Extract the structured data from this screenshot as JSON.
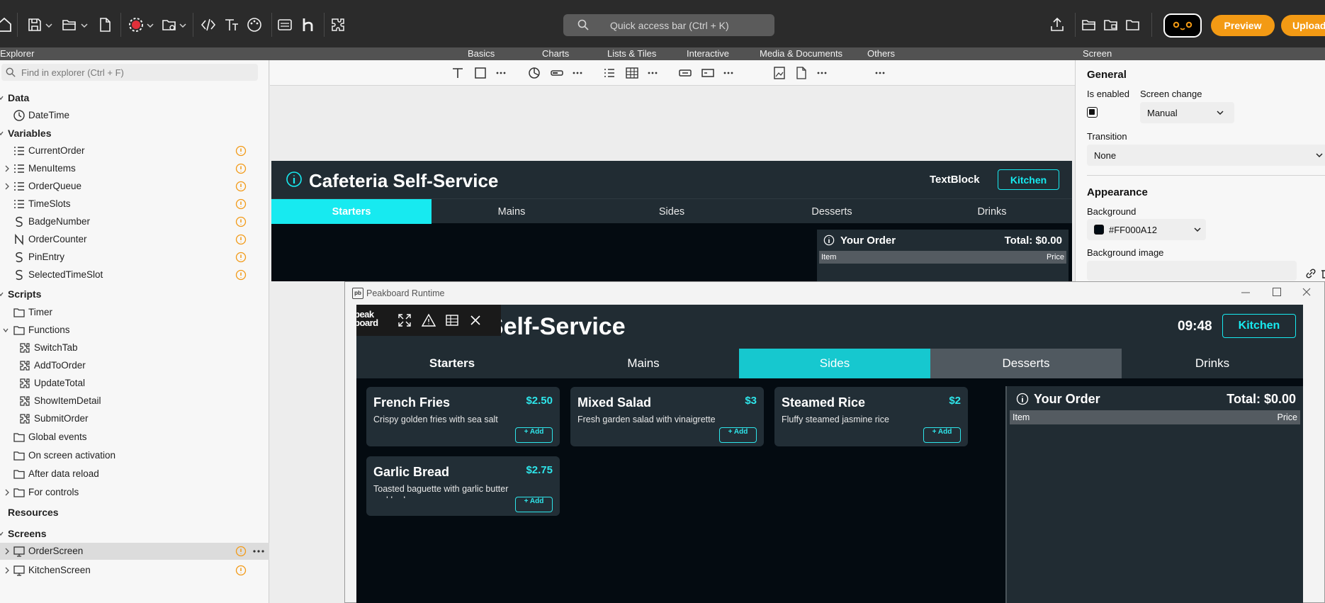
{
  "topbar": {
    "quick_access_placeholder": "Quick access bar (Ctrl + K)",
    "preview_label": "Preview",
    "upload_label": "Upload"
  },
  "ribbon": {
    "explorer_title": "Explorer",
    "categories": [
      "Basics",
      "Charts",
      "Lists & Tiles",
      "Interactive",
      "Media & Documents",
      "Others"
    ],
    "screen_title": "Screen"
  },
  "explorer": {
    "search_placeholder": "Find in explorer (Ctrl + F)",
    "rows": [
      {
        "label": "Data",
        "section": true
      },
      {
        "label": "DateTime"
      },
      {
        "label": "Variables",
        "section": true
      },
      {
        "label": "CurrentOrder"
      },
      {
        "label": "MenuItems"
      },
      {
        "label": "OrderQueue"
      },
      {
        "label": "TimeSlots"
      },
      {
        "label": "BadgeNumber"
      },
      {
        "label": "OrderCounter"
      },
      {
        "label": "PinEntry"
      },
      {
        "label": "SelectedTimeSlot"
      },
      {
        "label": "Scripts",
        "section": true
      },
      {
        "label": "Timer"
      },
      {
        "label": "Functions"
      },
      {
        "label": "SwitchTab"
      },
      {
        "label": "AddToOrder"
      },
      {
        "label": "UpdateTotal"
      },
      {
        "label": "ShowItemDetail"
      },
      {
        "label": "SubmitOrder"
      },
      {
        "label": "Global events"
      },
      {
        "label": "On screen activation"
      },
      {
        "label": "After data reload"
      },
      {
        "label": "For controls"
      },
      {
        "label": "Resources",
        "section": true
      },
      {
        "label": "Screens",
        "section": true
      },
      {
        "label": "OrderScreen"
      },
      {
        "label": "KitchenScreen"
      }
    ]
  },
  "design": {
    "title": "Cafeteria Self-Service",
    "textblock": "TextBlock",
    "kitchen_button": "Kitchen",
    "tabs": [
      "Starters",
      "Mains",
      "Sides",
      "Desserts",
      "Drinks"
    ],
    "order_title": "Your Order",
    "order_total": "Total: $0.00",
    "col_item": "Item",
    "col_price": "Price"
  },
  "props": {
    "general": "General",
    "is_enabled": "Is enabled",
    "screen_change": "Screen change",
    "screen_change_value": "Manual",
    "transition": "Transition",
    "transition_value": "None",
    "appearance": "Appearance",
    "background": "Background",
    "background_value": "#FF000A12",
    "background_image": "Background image"
  },
  "runtime": {
    "window_title": "Peakboard Runtime",
    "logo_text": "peak board",
    "app_title": "Cafeteria Self-Service",
    "clock": "09:48",
    "kitchen_button": "Kitchen",
    "tabs": [
      "Starters",
      "Mains",
      "Sides",
      "Desserts",
      "Drinks"
    ],
    "cards": [
      {
        "name": "French Fries",
        "price": "$2.50",
        "desc": "Crispy golden fries with sea salt",
        "add": "+ Add"
      },
      {
        "name": "Mixed Salad",
        "price": "$3",
        "desc": "Fresh garden salad with vinaigrette",
        "add": "+ Add"
      },
      {
        "name": "Steamed Rice",
        "price": "$2",
        "desc": "Fluffy steamed jasmine rice",
        "add": "+ Add"
      },
      {
        "name": "Garlic Bread",
        "price": "$2.75",
        "desc": "Toasted baguette with garlic butter and herbs",
        "add": "+ Add"
      }
    ],
    "order_title": "Your Order",
    "order_total": "Total: $0.00",
    "col_item": "Item",
    "col_price": "Price"
  },
  "colors": {
    "accent": "#f39a14",
    "cyan": "#17eaf0",
    "dark_bg": "#040b11",
    "panel": "#212c33"
  }
}
